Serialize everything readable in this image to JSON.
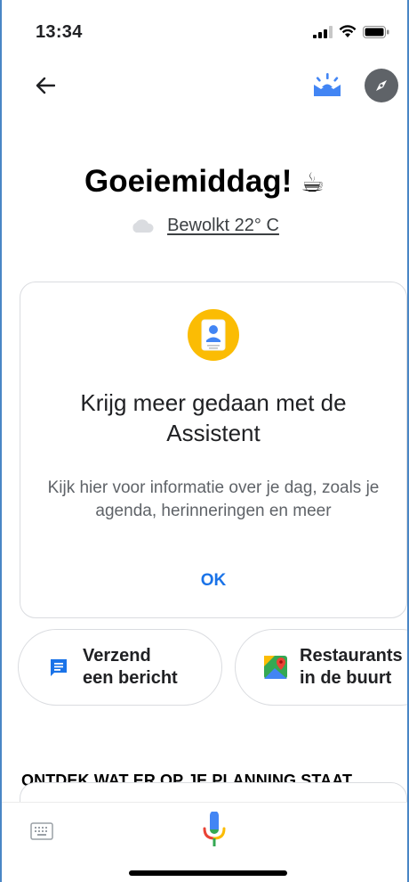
{
  "status_bar": {
    "time": "13:34"
  },
  "top_bar": {
    "back_icon": "arrow-left-icon",
    "snapshot_icon": "sunrise-icon",
    "explore_icon": "compass-icon"
  },
  "greeting": {
    "text": "Goeiemiddag!",
    "emoji": "☕"
  },
  "weather": {
    "icon": "cloud-icon",
    "text": "Bewolkt 22° C"
  },
  "card": {
    "icon": "clipboard-icon",
    "title": "Krijg meer gedaan met de Assistent",
    "description": "Kijk hier voor informatie over je dag, zoals je agenda, herinneringen en meer",
    "ok_label": "OK"
  },
  "chips": [
    {
      "label": "Verzend\neen bericht",
      "icon": "message-icon"
    },
    {
      "label": "Restaurants\nin de buurt",
      "icon": "maps-icon"
    }
  ],
  "section": {
    "title": "ONTDEK WAT ER OP JE PLANNING STAAT"
  },
  "bottom_bar": {
    "keyboard_icon": "keyboard-icon",
    "mic_icon": "microphone-icon"
  },
  "colors": {
    "accent": "#1a73e8",
    "card_icon_bg": "#fbbc04",
    "snapshot_blue": "#4285f4"
  }
}
